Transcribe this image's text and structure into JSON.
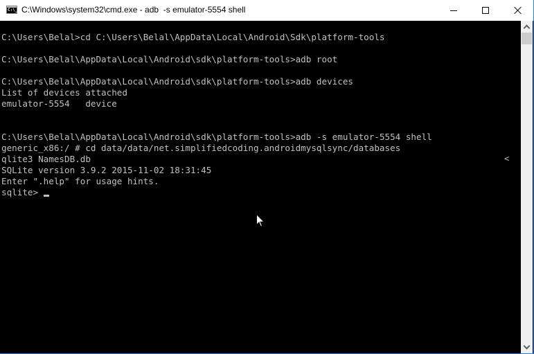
{
  "window": {
    "title": "C:\\Windows\\system32\\cmd.exe - adb  -s emulator-5554 shell",
    "icon": "cmd-icon",
    "icon_text": "C:\\_",
    "controls": {
      "minimize": "minimize-icon",
      "maximize": "maximize-icon",
      "close": "close-icon"
    }
  },
  "console": {
    "lines": [
      "C:\\Users\\Belal>cd C:\\Users\\Belal\\AppData\\Local\\Android\\Sdk\\platform-tools",
      "",
      "C:\\Users\\Belal\\AppData\\Local\\Android\\sdk\\platform-tools>adb root",
      "",
      "C:\\Users\\Belal\\AppData\\Local\\Android\\sdk\\platform-tools>adb devices",
      "List of devices attached",
      "emulator-5554   device",
      "",
      "",
      "C:\\Users\\Belal\\AppData\\Local\\Android\\sdk\\platform-tools>adb -s emulator-5554 shell",
      "generic_x86:/ # cd data/data/net.simplifiedcoding.androidmysqlsync/databases",
      "qlite3 NamesDB.db",
      "SQLite version 3.9.2 2015-11-02 18:31:45",
      "Enter \".help\" for usage hints."
    ],
    "prompt": "sqlite> ",
    "overflow_marker": "<",
    "text_color": "#c0c0c0",
    "background_color": "#000000"
  },
  "scrollbar": {
    "up_icon": "chevron-up-icon",
    "down_icon": "chevron-down-icon"
  },
  "accent_color": "#2b79d0"
}
